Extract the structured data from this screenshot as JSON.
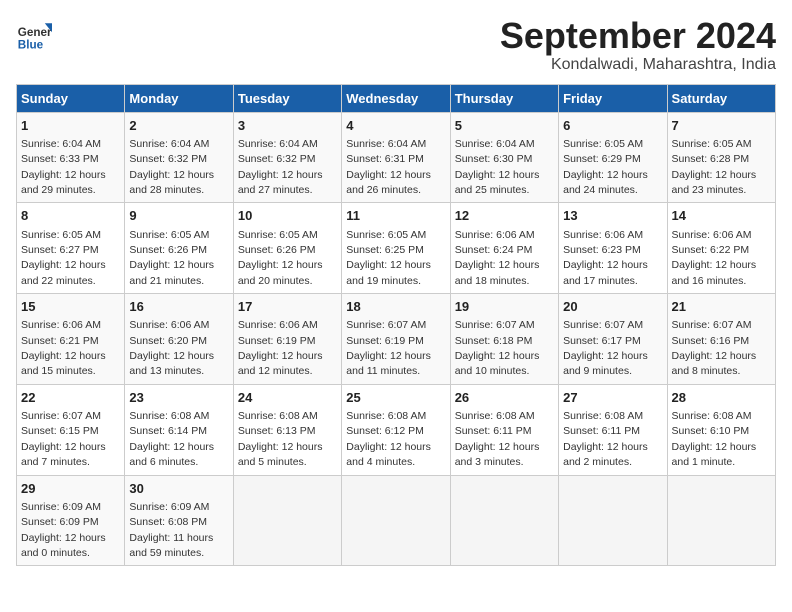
{
  "logo": {
    "text_general": "General",
    "text_blue": "Blue"
  },
  "title": "September 2024",
  "subtitle": "Kondalwadi, Maharashtra, India",
  "weekdays": [
    "Sunday",
    "Monday",
    "Tuesday",
    "Wednesday",
    "Thursday",
    "Friday",
    "Saturday"
  ],
  "weeks": [
    [
      {
        "day": "1",
        "sunrise": "6:04 AM",
        "sunset": "6:33 PM",
        "daylight": "12 hours and 29 minutes."
      },
      {
        "day": "2",
        "sunrise": "6:04 AM",
        "sunset": "6:32 PM",
        "daylight": "12 hours and 28 minutes."
      },
      {
        "day": "3",
        "sunrise": "6:04 AM",
        "sunset": "6:32 PM",
        "daylight": "12 hours and 27 minutes."
      },
      {
        "day": "4",
        "sunrise": "6:04 AM",
        "sunset": "6:31 PM",
        "daylight": "12 hours and 26 minutes."
      },
      {
        "day": "5",
        "sunrise": "6:04 AM",
        "sunset": "6:30 PM",
        "daylight": "12 hours and 25 minutes."
      },
      {
        "day": "6",
        "sunrise": "6:05 AM",
        "sunset": "6:29 PM",
        "daylight": "12 hours and 24 minutes."
      },
      {
        "day": "7",
        "sunrise": "6:05 AM",
        "sunset": "6:28 PM",
        "daylight": "12 hours and 23 minutes."
      }
    ],
    [
      {
        "day": "8",
        "sunrise": "6:05 AM",
        "sunset": "6:27 PM",
        "daylight": "12 hours and 22 minutes."
      },
      {
        "day": "9",
        "sunrise": "6:05 AM",
        "sunset": "6:26 PM",
        "daylight": "12 hours and 21 minutes."
      },
      {
        "day": "10",
        "sunrise": "6:05 AM",
        "sunset": "6:26 PM",
        "daylight": "12 hours and 20 minutes."
      },
      {
        "day": "11",
        "sunrise": "6:05 AM",
        "sunset": "6:25 PM",
        "daylight": "12 hours and 19 minutes."
      },
      {
        "day": "12",
        "sunrise": "6:06 AM",
        "sunset": "6:24 PM",
        "daylight": "12 hours and 18 minutes."
      },
      {
        "day": "13",
        "sunrise": "6:06 AM",
        "sunset": "6:23 PM",
        "daylight": "12 hours and 17 minutes."
      },
      {
        "day": "14",
        "sunrise": "6:06 AM",
        "sunset": "6:22 PM",
        "daylight": "12 hours and 16 minutes."
      }
    ],
    [
      {
        "day": "15",
        "sunrise": "6:06 AM",
        "sunset": "6:21 PM",
        "daylight": "12 hours and 15 minutes."
      },
      {
        "day": "16",
        "sunrise": "6:06 AM",
        "sunset": "6:20 PM",
        "daylight": "12 hours and 13 minutes."
      },
      {
        "day": "17",
        "sunrise": "6:06 AM",
        "sunset": "6:19 PM",
        "daylight": "12 hours and 12 minutes."
      },
      {
        "day": "18",
        "sunrise": "6:07 AM",
        "sunset": "6:19 PM",
        "daylight": "12 hours and 11 minutes."
      },
      {
        "day": "19",
        "sunrise": "6:07 AM",
        "sunset": "6:18 PM",
        "daylight": "12 hours and 10 minutes."
      },
      {
        "day": "20",
        "sunrise": "6:07 AM",
        "sunset": "6:17 PM",
        "daylight": "12 hours and 9 minutes."
      },
      {
        "day": "21",
        "sunrise": "6:07 AM",
        "sunset": "6:16 PM",
        "daylight": "12 hours and 8 minutes."
      }
    ],
    [
      {
        "day": "22",
        "sunrise": "6:07 AM",
        "sunset": "6:15 PM",
        "daylight": "12 hours and 7 minutes."
      },
      {
        "day": "23",
        "sunrise": "6:08 AM",
        "sunset": "6:14 PM",
        "daylight": "12 hours and 6 minutes."
      },
      {
        "day": "24",
        "sunrise": "6:08 AM",
        "sunset": "6:13 PM",
        "daylight": "12 hours and 5 minutes."
      },
      {
        "day": "25",
        "sunrise": "6:08 AM",
        "sunset": "6:12 PM",
        "daylight": "12 hours and 4 minutes."
      },
      {
        "day": "26",
        "sunrise": "6:08 AM",
        "sunset": "6:11 PM",
        "daylight": "12 hours and 3 minutes."
      },
      {
        "day": "27",
        "sunrise": "6:08 AM",
        "sunset": "6:11 PM",
        "daylight": "12 hours and 2 minutes."
      },
      {
        "day": "28",
        "sunrise": "6:08 AM",
        "sunset": "6:10 PM",
        "daylight": "12 hours and 1 minute."
      }
    ],
    [
      {
        "day": "29",
        "sunrise": "6:09 AM",
        "sunset": "6:09 PM",
        "daylight": "12 hours and 0 minutes."
      },
      {
        "day": "30",
        "sunrise": "6:09 AM",
        "sunset": "6:08 PM",
        "daylight": "11 hours and 59 minutes."
      },
      null,
      null,
      null,
      null,
      null
    ]
  ],
  "labels": {
    "sunrise": "Sunrise: ",
    "sunset": "Sunset: ",
    "daylight": "Daylight: "
  }
}
